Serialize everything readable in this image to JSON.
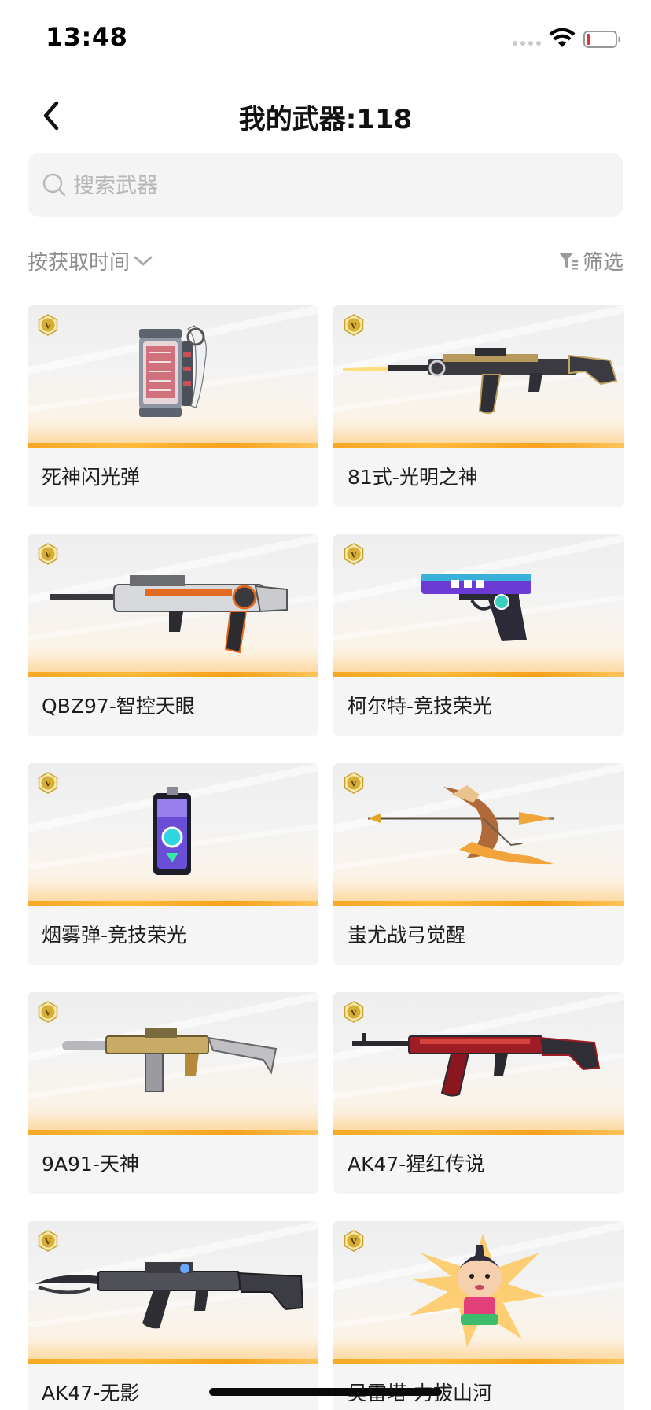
{
  "status_bar": {
    "time": "13:48"
  },
  "header": {
    "title": "我的武器:118"
  },
  "search": {
    "placeholder": "搜索武器"
  },
  "toolbar": {
    "sort_label": "按获取时间",
    "filter_label": "筛选"
  },
  "colors": {
    "accent_orange": "#f9a21c",
    "badge_gold": "#c9a227",
    "text_primary": "#1c1c1c",
    "text_secondary": "#8c8c8c"
  },
  "weapons": [
    {
      "name": "死神闪光弹",
      "badge": "V",
      "icon": "flashbang-grenade-icon"
    },
    {
      "name": "81式-光明之神",
      "badge": "V",
      "icon": "assault-rifle-icon"
    },
    {
      "name": "QBZ97-智控天眼",
      "badge": "V",
      "icon": "bullpup-rifle-icon"
    },
    {
      "name": "柯尔特-竞技荣光",
      "badge": "V",
      "icon": "pistol-icon"
    },
    {
      "name": "烟雾弹-竞技荣光",
      "badge": "V",
      "icon": "smoke-grenade-icon"
    },
    {
      "name": "蚩尤战弓觉醒",
      "badge": "V",
      "icon": "bow-icon"
    },
    {
      "name": "9A91-天神",
      "badge": "V",
      "icon": "suppressed-rifle-icon"
    },
    {
      "name": "AK47-猩红传说",
      "badge": "V",
      "icon": "ak47-red-icon"
    },
    {
      "name": "AK47-无影",
      "badge": "V",
      "icon": "ak47-blade-icon"
    },
    {
      "name": "吴雷塔-力拔山河",
      "badge": "V",
      "icon": "character-icon"
    }
  ]
}
